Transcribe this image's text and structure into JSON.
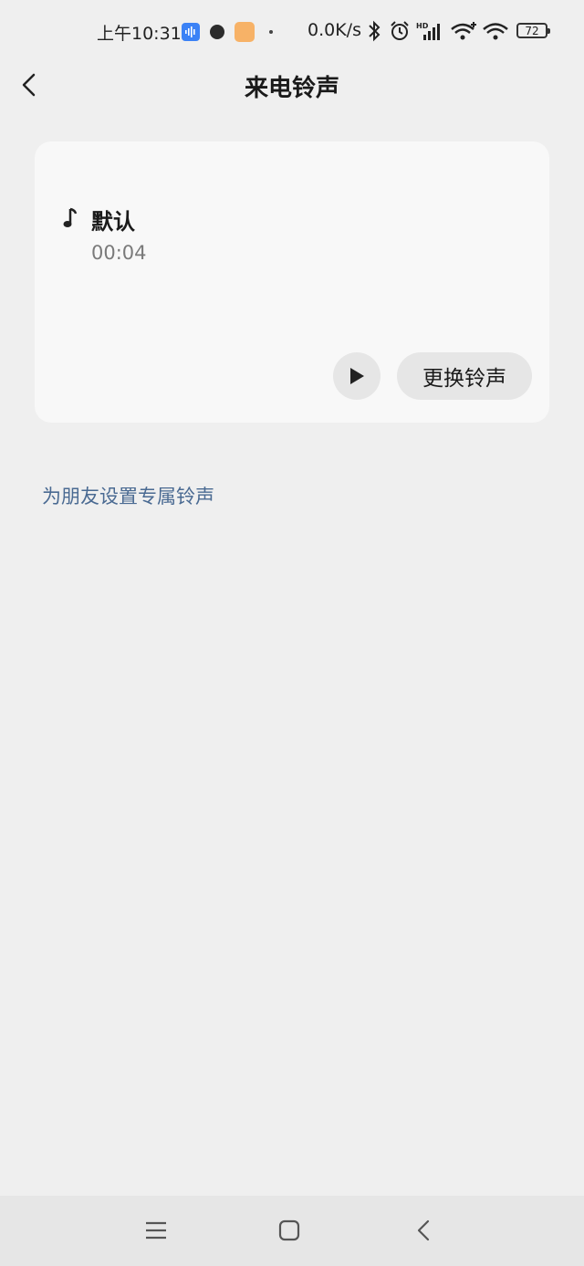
{
  "status_bar": {
    "time": "上午10:31",
    "network_speed": "0.0K/s",
    "battery": "72",
    "icons": [
      "voice-app-icon",
      "circle-app-icon",
      "cartoon-app-icon",
      "dot-icon",
      "bluetooth-icon",
      "alarm-icon",
      "hd-signal-icon",
      "wifi-plus-icon",
      "wifi-icon",
      "battery-icon"
    ]
  },
  "header": {
    "title": "来电铃声",
    "back_icon": "chevron-left-icon"
  },
  "ringtone": {
    "name": "默认",
    "duration": "00:04",
    "icon": "music-note-icon",
    "play_icon": "play-icon",
    "change_label": "更换铃声"
  },
  "friend_link": {
    "label": "为朋友设置专属铃声",
    "color": "#4a6a92"
  },
  "nav_bar": {
    "icons": [
      "menu-icon",
      "home-icon",
      "back-icon"
    ]
  },
  "colors": {
    "background": "#efefef",
    "card": "#f8f8f8",
    "button": "#e6e6e6",
    "link": "#4a6a92"
  }
}
